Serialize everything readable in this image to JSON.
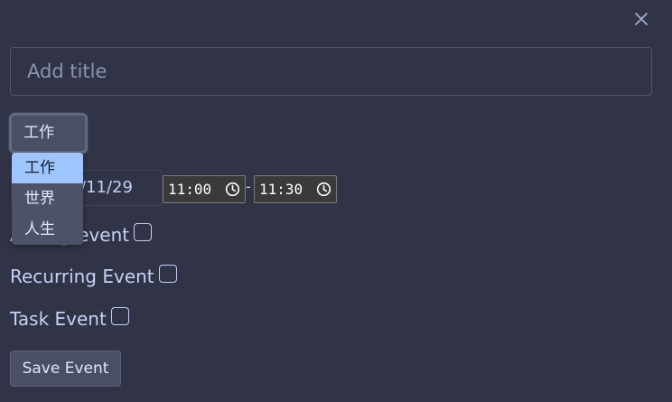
{
  "form": {
    "title_placeholder": "Add title",
    "calendar_selected": "工作",
    "calendar_options": [
      "工作",
      "世界",
      "人生"
    ],
    "date_value_visible": "/11/29",
    "time_start": "11:00",
    "time_end": "11:30",
    "time_separator": "-",
    "allday_label": "All-day event",
    "allday_visible": "event",
    "recurring_label": "Recurring Event",
    "task_label": "Task Event",
    "save_label": "Save Event"
  },
  "icons": {
    "close": "close-icon",
    "clock": "clock-icon"
  },
  "colors": {
    "background": "#303446",
    "text": "#c6d0f5",
    "dropdown_highlight": "#9ec5fe"
  }
}
